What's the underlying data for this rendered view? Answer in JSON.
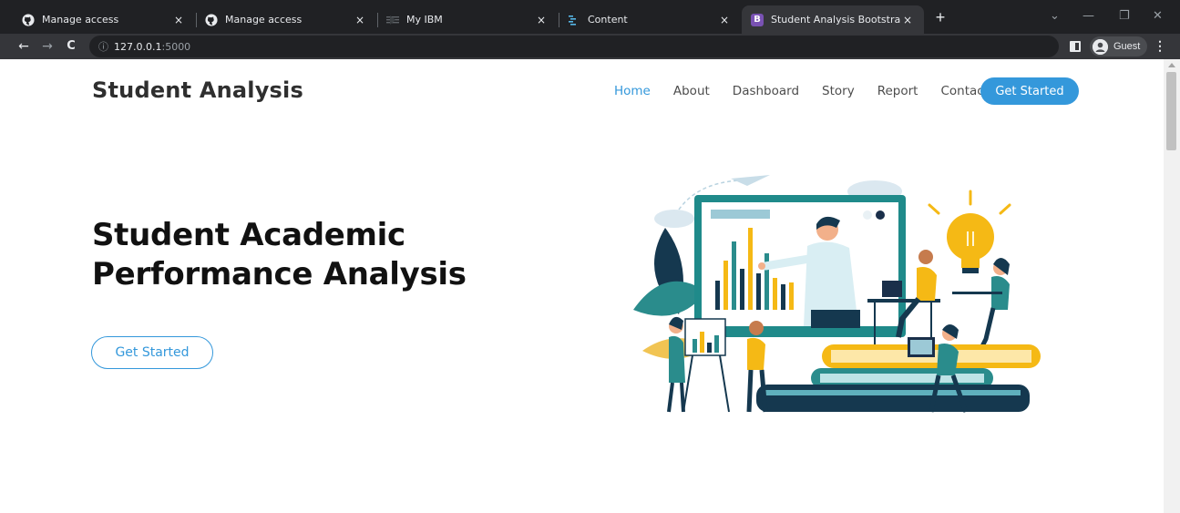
{
  "browser": {
    "tabs": [
      {
        "title": "Manage access",
        "icon": "github-icon",
        "active": false
      },
      {
        "title": "Manage access",
        "icon": "github-icon",
        "active": false
      },
      {
        "title": "My IBM",
        "icon": "ibm-icon",
        "active": false
      },
      {
        "title": "Content",
        "icon": "content-icon",
        "active": false
      },
      {
        "title": "Student Analysis Bootstrap Temp",
        "icon": "bootstrap-icon",
        "active": true
      }
    ],
    "bootstrap_favicon_letter": "B",
    "close_glyph": "×",
    "new_tab_glyph": "+",
    "window_controls": {
      "dropdown": "⌄",
      "minimize": "—",
      "restore": "❐",
      "close": "✕"
    },
    "nav": {
      "back": "←",
      "forward": "→",
      "reload": "C"
    },
    "url": {
      "info": "ⓘ",
      "host": "127.0.0.1",
      "port": ":5000"
    },
    "profile_label": "Guest",
    "menu_glyph": "⋮",
    "accent": "#3498db"
  },
  "site": {
    "brand": "Student Analysis",
    "nav": [
      {
        "label": "Home",
        "active": true
      },
      {
        "label": "About",
        "active": false
      },
      {
        "label": "Dashboard",
        "active": false
      },
      {
        "label": "Story",
        "active": false
      },
      {
        "label": "Report",
        "active": false
      },
      {
        "label": "Contact",
        "active": false
      }
    ],
    "cta_label": "Get Started",
    "hero": {
      "title_line1": "Student Academic",
      "title_line2": "Performance Analysis",
      "button_label": "Get Started"
    }
  }
}
